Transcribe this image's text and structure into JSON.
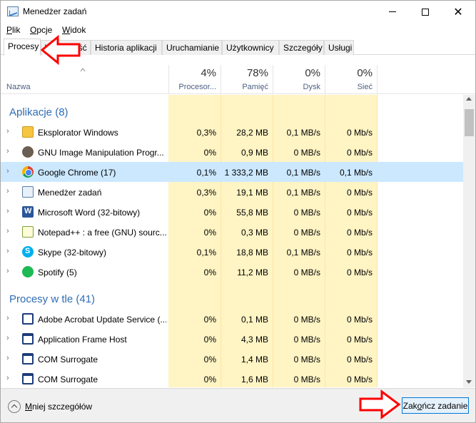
{
  "window": {
    "title": "Menedżer zadań"
  },
  "menu": [
    {
      "label": "Plik",
      "u": "P",
      "rest": "lik"
    },
    {
      "label": "Opcje",
      "u": "O",
      "rest": "pcje"
    },
    {
      "label": "Widok",
      "u": "W",
      "rest": "idok"
    }
  ],
  "tabs": [
    "Procesy",
    "Wydajność",
    "Historia aplikacji",
    "Uruchamianie",
    "Użytkownicy",
    "Szczegóły",
    "Usługi"
  ],
  "columns": {
    "name": "Nazwa",
    "cpu": {
      "pct": "4%",
      "label": "Procesor..."
    },
    "memory": {
      "pct": "78%",
      "label": "Pamięć"
    },
    "disk": {
      "pct": "0%",
      "label": "Dysk"
    },
    "network": {
      "pct": "0%",
      "label": "Sieć"
    }
  },
  "groups": {
    "apps": "Aplikacje (8)",
    "background": "Procesy w tle (41)"
  },
  "apps": [
    {
      "name": "Eksplorator Windows",
      "icon": "folder-icon",
      "cpu": "0,3%",
      "mem": "28,2 MB",
      "disk": "0,1 MB/s",
      "net": "0 Mb/s"
    },
    {
      "name": "GNU Image Manipulation Progr...",
      "icon": "gimp-icon",
      "cpu": "0%",
      "mem": "0,9 MB",
      "disk": "0 MB/s",
      "net": "0 Mb/s"
    },
    {
      "name": "Google Chrome (17)",
      "icon": "chrome-icon",
      "cpu": "0,1%",
      "mem": "1 333,2 MB",
      "disk": "0,1 MB/s",
      "net": "0,1 Mb/s"
    },
    {
      "name": "Menedżer zadań",
      "icon": "task-manager-icon",
      "cpu": "0,3%",
      "mem": "19,1 MB",
      "disk": "0,1 MB/s",
      "net": "0 Mb/s"
    },
    {
      "name": "Microsoft Word (32-bitowy)",
      "icon": "word-icon",
      "cpu": "0%",
      "mem": "55,8 MB",
      "disk": "0 MB/s",
      "net": "0 Mb/s"
    },
    {
      "name": "Notepad++ : a free (GNU) sourc...",
      "icon": "notepad-icon",
      "cpu": "0%",
      "mem": "0,3 MB",
      "disk": "0 MB/s",
      "net": "0 Mb/s"
    },
    {
      "name": "Skype (32-bitowy)",
      "icon": "skype-icon",
      "cpu": "0,1%",
      "mem": "18,8 MB",
      "disk": "0,1 MB/s",
      "net": "0 Mb/s"
    },
    {
      "name": "Spotify (5)",
      "icon": "spotify-icon",
      "cpu": "0%",
      "mem": "11,2 MB",
      "disk": "0 MB/s",
      "net": "0 Mb/s"
    }
  ],
  "background": [
    {
      "name": "Adobe Acrobat Update Service (...",
      "icon": "acrobat-icon",
      "cpu": "0%",
      "mem": "0,1 MB",
      "disk": "0 MB/s",
      "net": "0 Mb/s"
    },
    {
      "name": "Application Frame Host",
      "icon": "app-frame-icon",
      "cpu": "0%",
      "mem": "4,3 MB",
      "disk": "0 MB/s",
      "net": "0 Mb/s"
    },
    {
      "name": "COM Surrogate",
      "icon": "app-frame-icon",
      "cpu": "0%",
      "mem": "1,4 MB",
      "disk": "0 MB/s",
      "net": "0 Mb/s"
    },
    {
      "name": "COM Surrogate",
      "icon": "app-frame-icon",
      "cpu": "0%",
      "mem": "1,6 MB",
      "disk": "0 MB/s",
      "net": "0 Mb/s"
    }
  ],
  "footer": {
    "fewer_details": "Mniej szczegółów",
    "fewer_u": "M",
    "fewer_rest": "niej szczegółów",
    "end_task": "Zakończ zadanie",
    "end_task_pre": "Zak",
    "end_task_u": "o",
    "end_task_post": "ńcz zadanie"
  },
  "colors": {
    "group_label": "#2f6db5",
    "heat": "#fff4c4",
    "selected_row": "#cce8ff",
    "annotation": "#ff0000"
  }
}
